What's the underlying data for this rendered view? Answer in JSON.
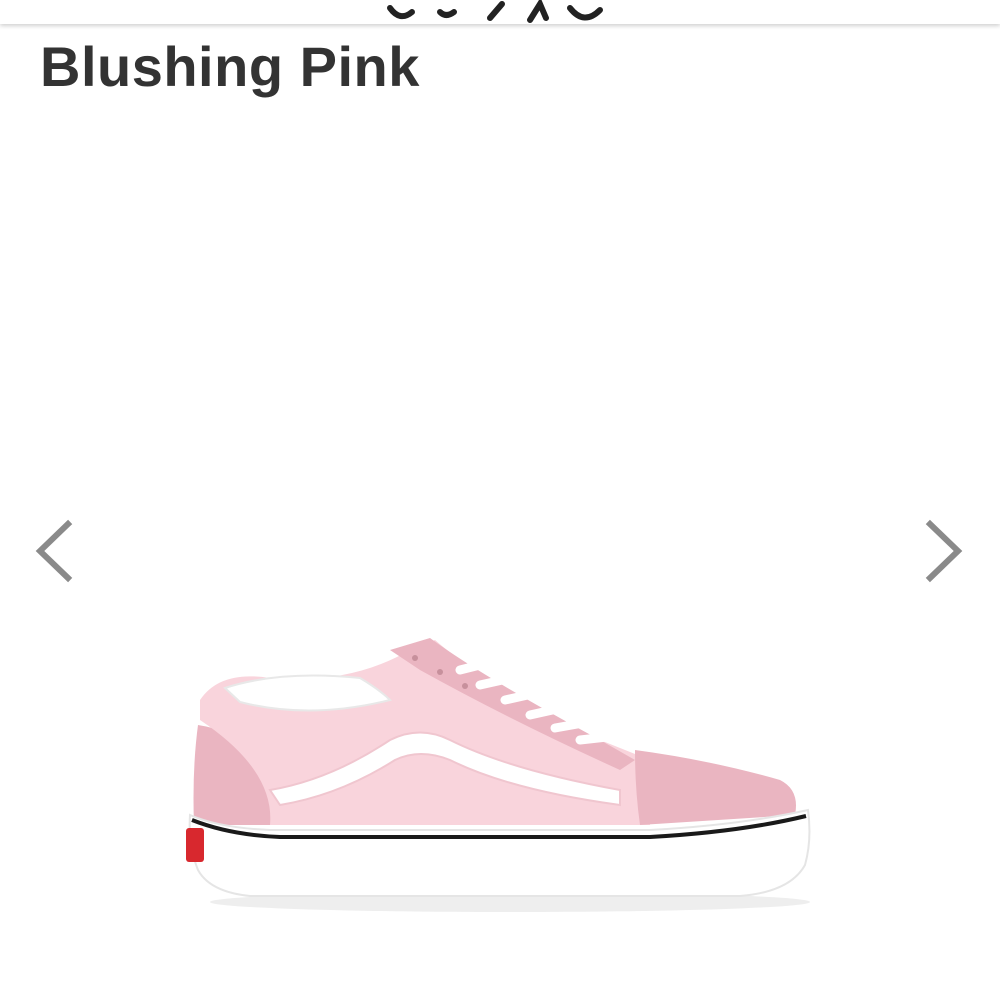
{
  "product": {
    "title": "Blushing Pink",
    "image": {
      "description_icon": "sneaker-image",
      "colors": {
        "upper_light": "#f9d4dc",
        "suede": "#eab5c1",
        "sole": "#ffffff",
        "stripe": "#1a1a1a",
        "heel_tab": "#d8282e"
      }
    }
  },
  "carousel": {
    "prev_icon": "chevron-left-icon",
    "next_icon": "chevron-right-icon",
    "arrow_color": "#8a8a8a"
  }
}
